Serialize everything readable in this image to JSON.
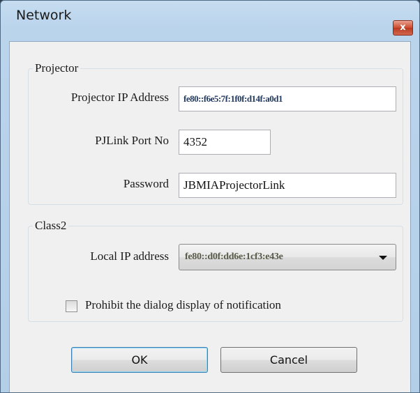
{
  "window": {
    "title": "Network",
    "close_glyph": "x"
  },
  "projector_group": {
    "legend": "Projector",
    "ip_label": "Projector IP Address",
    "ip_value": "fe80::f6e5:7f:1f0f:d14f:a0d1",
    "port_label": "PJLink Port No",
    "port_value": "4352",
    "password_label": "Password",
    "password_value": "JBMIAProjectorLink"
  },
  "class2_group": {
    "legend": "Class2",
    "local_ip_label": "Local IP address",
    "local_ip_value": "fe80::d0f:dd6e:1cf3:e43e",
    "prohibit_label": "Prohibit the dialog display of notification",
    "prohibit_checked": false
  },
  "buttons": {
    "ok": "OK",
    "cancel": "Cancel"
  },
  "icons": {
    "close": "close-icon",
    "dropdown": "chevron-down-icon"
  }
}
